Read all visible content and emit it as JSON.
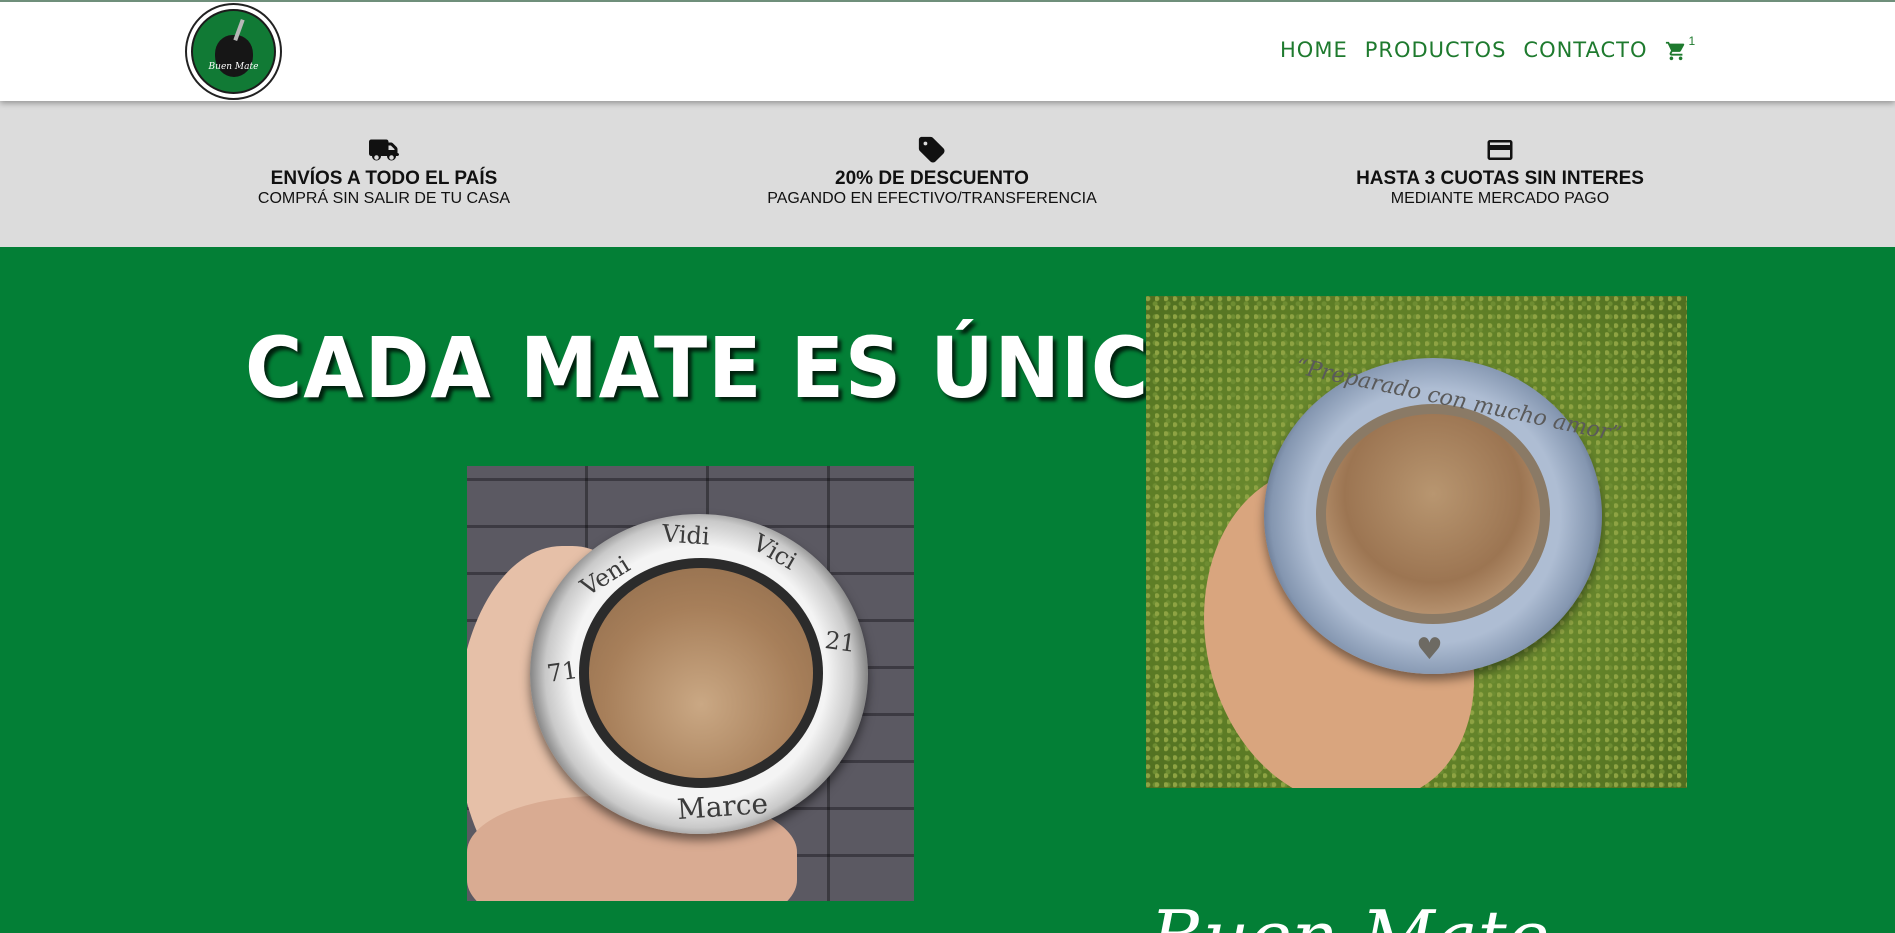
{
  "brand": {
    "logo_text": "Buen Mate"
  },
  "nav": {
    "items": [
      {
        "label": "HOME"
      },
      {
        "label": "PRODUCTOS"
      },
      {
        "label": "CONTACTO"
      }
    ],
    "cart_icon": "shopping-cart-icon",
    "cart_count": "1"
  },
  "features": [
    {
      "icon": "truck-icon",
      "title": "ENVÍOS A TODO EL PAÍS",
      "subtitle": "COMPRÁ SIN SALIR DE TU CASA"
    },
    {
      "icon": "tag-icon",
      "title": "20% DE DESCUENTO",
      "subtitle": "PAGANDO EN EFECTIVO/TRANSFERENCIA"
    },
    {
      "icon": "credit-card-icon",
      "title": "HASTA 3 CUOTAS SIN INTERES",
      "subtitle": "MEDIANTE MERCADO PAGO"
    }
  ],
  "hero": {
    "title": "CADA MATE ES ÚNICO",
    "photo_left": {
      "engraving_top": [
        "Veni",
        "Vidi",
        "Vici"
      ],
      "engraving_left": "71",
      "engraving_right": "21",
      "engraving_bottom": "Marce"
    },
    "photo_right": {
      "engraving": "“Preparado con mucho amor”"
    },
    "script_text": "Buen Mate"
  },
  "colors": {
    "nav_green": "#1e7a2e",
    "hero_green": "#037f36",
    "feature_bg": "#dcdcdc"
  }
}
